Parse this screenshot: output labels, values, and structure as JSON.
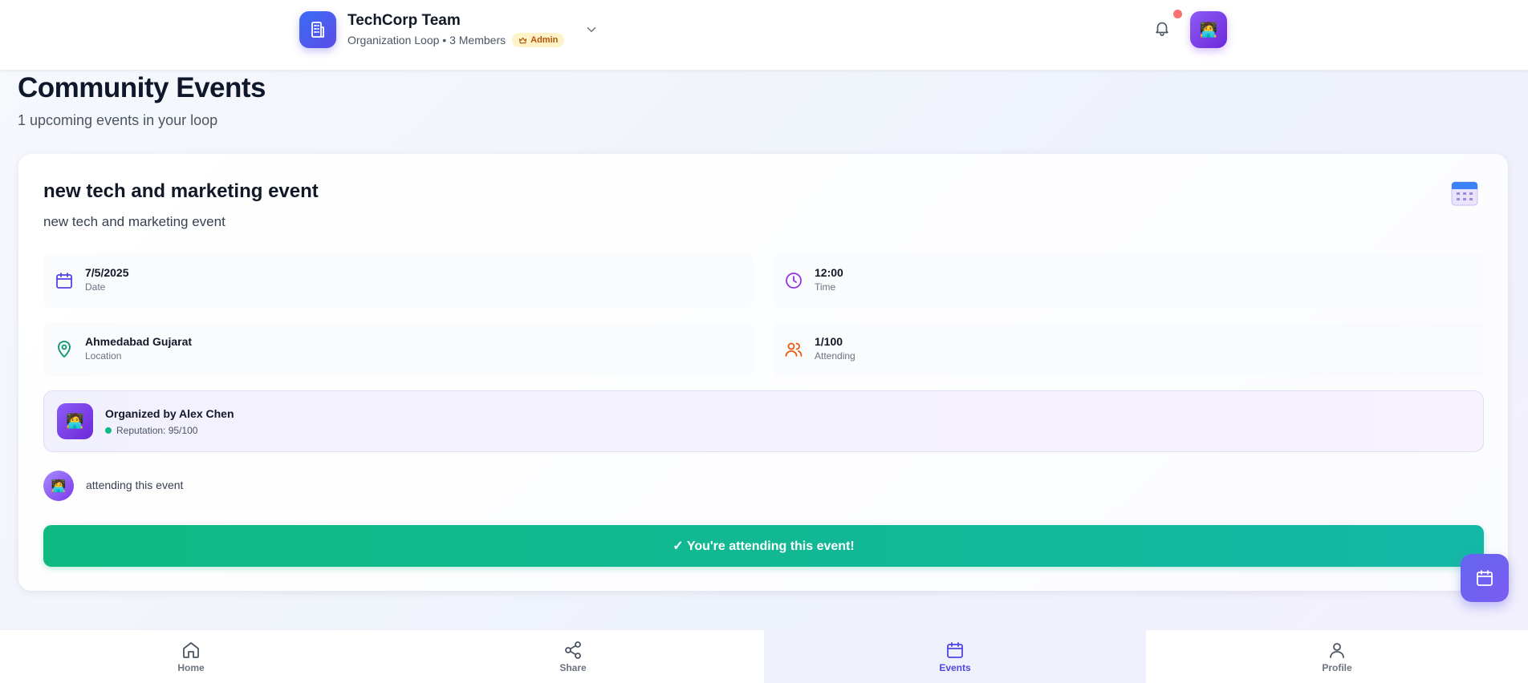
{
  "header": {
    "org_name": "TechCorp Team",
    "org_sub": "Organization Loop • 3 Members",
    "admin_badge": "Admin",
    "notification_dot_color": "#f87171",
    "org_avatar_emoji": "🧑‍💻",
    "accent": "#5b4ce6"
  },
  "page": {
    "title": "Community Events",
    "subtitle": "1 upcoming events in your loop"
  },
  "event": {
    "title": "new tech and marketing event",
    "description": "new tech and marketing event",
    "date_value": "7/5/2025",
    "date_label": "Date",
    "time_value": "12:00",
    "time_label": "Time",
    "location_value": "Ahmedabad Gujarat",
    "location_label": "Location",
    "attending_value": "1/100",
    "attending_label": "Attending",
    "organizer": "Organized by Alex Chen",
    "reputation": "Reputation: 95/100",
    "attendee_text": "attending this event",
    "attend_button": "✓ You're attending this event!"
  },
  "nav": {
    "home": "Home",
    "share": "Share",
    "events": "Events",
    "profile": "Profile",
    "active": "events"
  },
  "icons": {
    "avatar_emoji": "🧑‍💻"
  }
}
